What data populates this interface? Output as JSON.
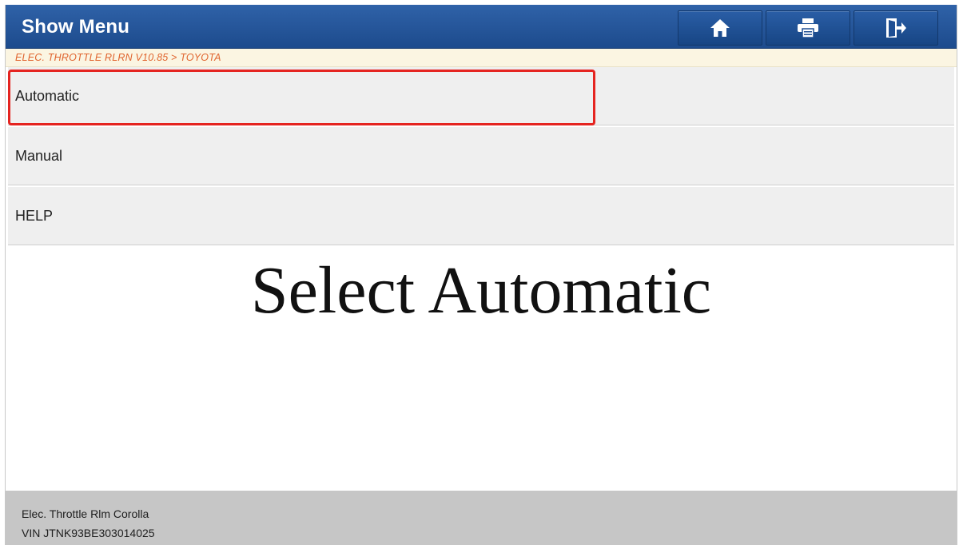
{
  "header": {
    "title": "Show Menu",
    "buttons": [
      {
        "name": "home",
        "icon": "home-icon"
      },
      {
        "name": "print",
        "icon": "printer-icon"
      },
      {
        "name": "exit",
        "icon": "exit-icon"
      }
    ]
  },
  "breadcrumb": "ELEC. THROTTLE RLRN V10.85 > TOYOTA",
  "menu": {
    "items": [
      {
        "label": "Automatic",
        "highlighted": true
      },
      {
        "label": "Manual"
      },
      {
        "label": "HELP"
      }
    ]
  },
  "overlay": {
    "caption": "Select Automatic"
  },
  "footer": {
    "line1": "Elec. Throttle Rlm Corolla",
    "line2": "VIN JTNK93BE303014025"
  },
  "colors": {
    "header_bg": "#1f4f93",
    "breadcrumb_text": "#e0642e",
    "highlight_border": "#e52420",
    "footer_bg": "#c6c6c6"
  }
}
